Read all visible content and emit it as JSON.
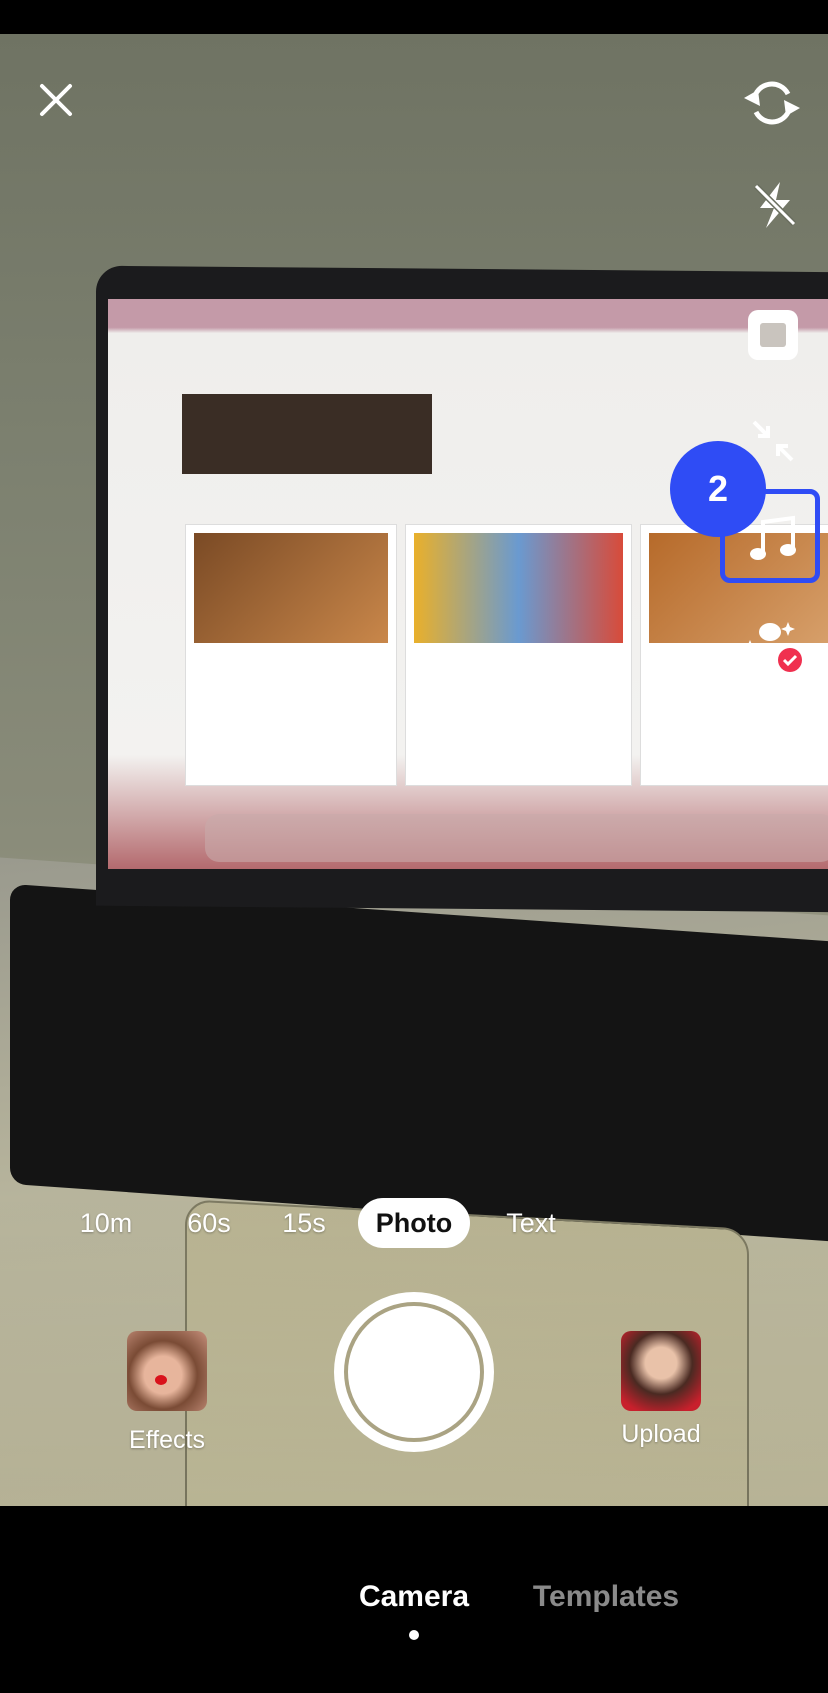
{
  "camera": {
    "top_controls": {
      "close_icon": "close-icon",
      "flip_icon": "flip-camera-icon",
      "flash_icon": "flash-off-icon"
    },
    "side_tools": [
      {
        "icon": "square-aspect-icon"
      },
      {
        "icon": "collapse-arrows-icon"
      },
      {
        "icon": "music-note-icon",
        "highlighted": true
      },
      {
        "icon": "person-beauty-icon"
      }
    ],
    "annotation": {
      "step_number": "2",
      "color": "#2f4cf5"
    },
    "modes": [
      {
        "label": "10m"
      },
      {
        "label": "60s"
      },
      {
        "label": "15s"
      },
      {
        "label": "Photo",
        "selected": true
      },
      {
        "label": "Text"
      }
    ],
    "effects_label": "Effects",
    "upload_label": "Upload",
    "shutter_icon": "shutter-button"
  },
  "bottom_nav": {
    "tabs": [
      {
        "label": "Camera",
        "active": true
      },
      {
        "label": "Templates",
        "active": false
      }
    ]
  }
}
